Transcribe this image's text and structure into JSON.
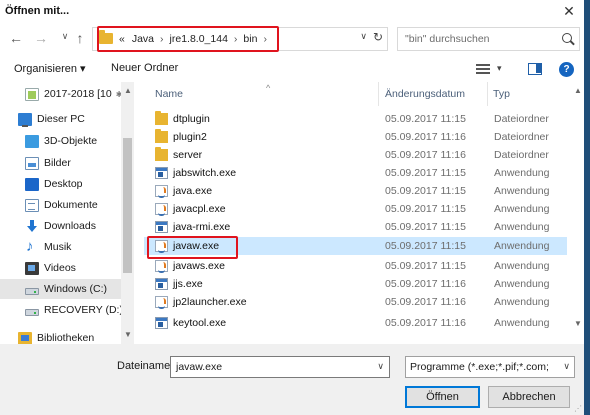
{
  "window": {
    "title": "Öffnen mit...",
    "close_glyph": "✕"
  },
  "nav": {
    "back_glyph": "←",
    "forward_glyph": "→",
    "up_glyph": "↑",
    "crumbs": [
      "«",
      "Java",
      "jre1.8.0_144",
      "bin"
    ],
    "separator": "›",
    "address_dropdown": "∨",
    "refresh_glyph": "↻",
    "search_placeholder": "\"bin\" durchsuchen"
  },
  "toolbar": {
    "organize_label": "Organisieren ▾",
    "new_folder_label": "Neuer Ordner",
    "view_dropdown": "▾",
    "help_label": "?"
  },
  "sidebar": {
    "items": [
      {
        "label": "2017-2018 [10",
        "icon": "recent-folder-icon",
        "pin": "📌"
      },
      {
        "label": "Dieser PC",
        "icon": "this-pc-icon"
      },
      {
        "label": "3D-Objekte",
        "icon": "3d-objects-icon"
      },
      {
        "label": "Bilder",
        "icon": "pictures-icon"
      },
      {
        "label": "Desktop",
        "icon": "desktop-icon"
      },
      {
        "label": "Dokumente",
        "icon": "documents-icon"
      },
      {
        "label": "Downloads",
        "icon": "downloads-icon"
      },
      {
        "label": "Musik",
        "icon": "music-icon"
      },
      {
        "label": "Videos",
        "icon": "videos-icon"
      },
      {
        "label": "Windows (C:)",
        "icon": "drive-icon"
      },
      {
        "label": "RECOVERY (D:)",
        "icon": "drive-icon"
      },
      {
        "label": "Bibliotheken",
        "icon": "libraries-icon"
      }
    ]
  },
  "filelist": {
    "columns": {
      "name": "Name",
      "date": "Änderungsdatum",
      "type": "Typ"
    },
    "sort_glyph": "^",
    "rows": [
      {
        "name": "dtplugin",
        "date": "05.09.2017 11:15",
        "type": "Dateiordner",
        "icon": "folder-icon"
      },
      {
        "name": "plugin2",
        "date": "05.09.2017 11:16",
        "type": "Dateiordner",
        "icon": "folder-icon"
      },
      {
        "name": "server",
        "date": "05.09.2017 11:16",
        "type": "Dateiordner",
        "icon": "folder-icon"
      },
      {
        "name": "jabswitch.exe",
        "date": "05.09.2017 11:15",
        "type": "Anwendung",
        "icon": "exe-icon"
      },
      {
        "name": "java.exe",
        "date": "05.09.2017 11:15",
        "type": "Anwendung",
        "icon": "java-icon"
      },
      {
        "name": "javacpl.exe",
        "date": "05.09.2017 11:15",
        "type": "Anwendung",
        "icon": "java-icon"
      },
      {
        "name": "java-rmi.exe",
        "date": "05.09.2017 11:15",
        "type": "Anwendung",
        "icon": "exe-icon"
      },
      {
        "name": "javaw.exe",
        "date": "05.09.2017 11:15",
        "type": "Anwendung",
        "icon": "java-icon",
        "selected": true
      },
      {
        "name": "javaws.exe",
        "date": "05.09.2017 11:15",
        "type": "Anwendung",
        "icon": "java-icon"
      },
      {
        "name": "jjs.exe",
        "date": "05.09.2017 11:16",
        "type": "Anwendung",
        "icon": "exe-icon"
      },
      {
        "name": "jp2launcher.exe",
        "date": "05.09.2017 11:16",
        "type": "Anwendung",
        "icon": "java-icon"
      },
      {
        "name": "keytool.exe",
        "date": "05.09.2017 11:16",
        "type": "Anwendung",
        "icon": "exe-icon"
      }
    ]
  },
  "footer": {
    "filename_label": "Dateiname:",
    "filename_value": "javaw.exe",
    "filename_dropdown": "∨",
    "filter_value": "Programme (*.exe;*.pif;*.com;",
    "filter_dropdown": "∨",
    "open_label": "Öffnen",
    "cancel_label": "Abbrechen"
  },
  "scroll": {
    "up": "▲",
    "down": "▼"
  },
  "colors": {
    "highlight": "#e0141e",
    "selection": "#cce8ff",
    "accent": "#0078d7"
  }
}
